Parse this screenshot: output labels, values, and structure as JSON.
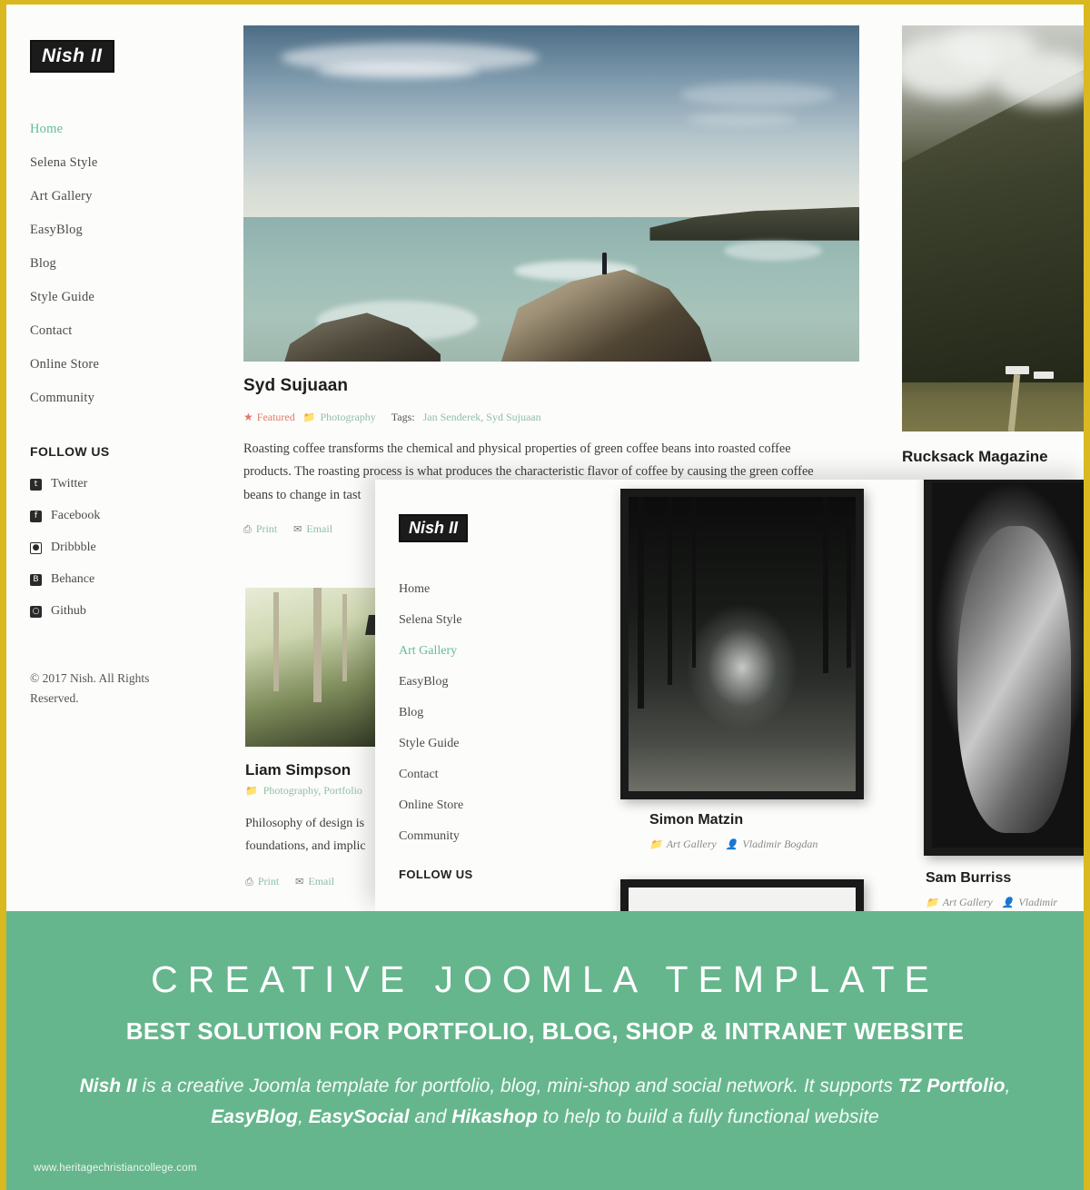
{
  "brand": {
    "logo": "Nish II",
    "accent_green": "#63bd94",
    "banner_green": "#66b68d",
    "frame_gold": "#d9b820"
  },
  "back_page": {
    "nav": [
      {
        "label": "Home",
        "active": true
      },
      {
        "label": "Selena Style",
        "active": false
      },
      {
        "label": "Art Gallery",
        "active": false
      },
      {
        "label": "EasyBlog",
        "active": false
      },
      {
        "label": "Blog",
        "active": false
      },
      {
        "label": "Style Guide",
        "active": false
      },
      {
        "label": "Contact",
        "active": false
      },
      {
        "label": "Online Store",
        "active": false
      },
      {
        "label": "Community",
        "active": false
      }
    ],
    "follow_title": "FOLLOW US",
    "social": [
      {
        "label": "Twitter",
        "icon": "twitter-icon",
        "glyph": "t"
      },
      {
        "label": "Facebook",
        "icon": "facebook-icon",
        "glyph": "f"
      },
      {
        "label": "Dribbble",
        "icon": "dribbble-icon",
        "glyph": "●"
      },
      {
        "label": "Behance",
        "icon": "behance-icon",
        "glyph": "B"
      },
      {
        "label": "Github",
        "icon": "github-icon",
        "glyph": "○"
      }
    ],
    "copyright": "© 2017 Nish. All Rights Reserved.",
    "article": {
      "title": "Syd Sujuaan",
      "featured_label": "Featured",
      "category": "Photography",
      "tags_label": "Tags:",
      "tags": "Jan Senderek, Syd Sujuaan",
      "body": "Roasting coffee transforms the chemical and physical properties of green coffee beans into roasted coffee products. The roasting process is what produces the characteristic flavor of coffee by causing the green coffee beans to change in tast",
      "print_label": "Print",
      "email_label": "Email",
      "image_alt": "person standing on coastal cliff overlooking the sea"
    },
    "article2": {
      "title": "Liam Simpson",
      "category": "Photography, Portfolio",
      "body": "Philosophy of design is foundations, and implic",
      "print_label": "Print",
      "email_label": "Email",
      "image_alt": "sunlit forest trees with lamp"
    },
    "right_card": {
      "title": "Rucksack Magazine",
      "image_alt": "misty mountain slope with camper van"
    }
  },
  "front_page": {
    "nav": [
      {
        "label": "Home",
        "active": false
      },
      {
        "label": "Selena Style",
        "active": false
      },
      {
        "label": "Art Gallery",
        "active": true
      },
      {
        "label": "EasyBlog",
        "active": false
      },
      {
        "label": "Blog",
        "active": false
      },
      {
        "label": "Style Guide",
        "active": false
      },
      {
        "label": "Contact",
        "active": false
      },
      {
        "label": "Online Store",
        "active": false
      },
      {
        "label": "Community",
        "active": false
      }
    ],
    "follow_title": "FOLLOW US",
    "gallery": [
      {
        "title": "Simon Matzin",
        "category": "Art Gallery",
        "author": "Vladimir Bogdan",
        "image_alt": "dark forest path black and white framed print"
      },
      {
        "title": "Sam Burriss",
        "category": "Art Gallery",
        "author": "Vladimir",
        "image_alt": "black and white portrait of a man framed print"
      }
    ]
  },
  "promo": {
    "headline": "CREATIVE JOOMLA TEMPLATE",
    "subheadline": "BEST SOLUTION FOR PORTFOLIO, BLOG, SHOP & INTRANET WEBSITE",
    "description_line1_pre": "",
    "description": "Nish II is a creative Joomla template for portfolio, blog, mini-shop and social network. It supports TZ Portfolio, EasyBlog, EasySocial and Hikashop to help to build a fully functional website",
    "watermark": "www.heritagechristiancollege.com"
  }
}
